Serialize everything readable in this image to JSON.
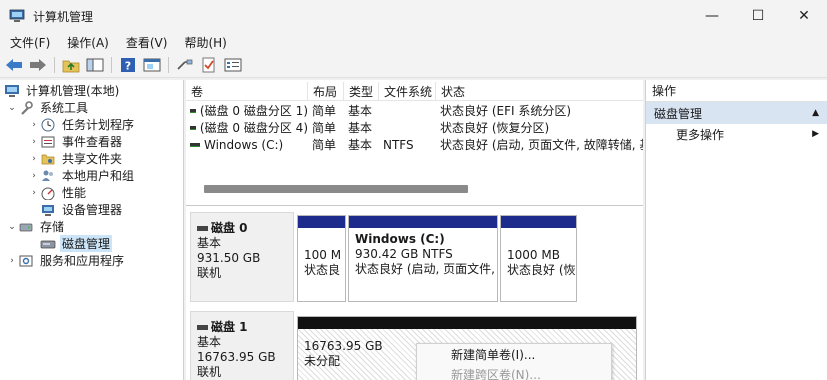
{
  "window": {
    "title": "计算机管理"
  },
  "window_controls": {
    "minimize": "—",
    "maximize": "☐",
    "close": "✕"
  },
  "menubar": {
    "items": [
      "文件(F)",
      "操作(A)",
      "查看(V)",
      "帮助(H)"
    ]
  },
  "tree": {
    "root": "计算机管理(本地)",
    "system_tools": "系统工具",
    "task_scheduler": "任务计划程序",
    "event_viewer": "事件查看器",
    "shared_folders": "共享文件夹",
    "local_users": "本地用户和组",
    "performance": "性能",
    "device_manager": "设备管理器",
    "storage": "存储",
    "disk_management": "磁盘管理",
    "services": "服务和应用程序"
  },
  "volume_list": {
    "columns": [
      "卷",
      "布局",
      "类型",
      "文件系统",
      "状态"
    ],
    "rows": [
      {
        "volume": "(磁盘 0 磁盘分区 1)",
        "layout": "简单",
        "type": "基本",
        "fs": "",
        "status": "状态良好 (EFI 系统分区)"
      },
      {
        "volume": "(磁盘 0 磁盘分区 4)",
        "layout": "简单",
        "type": "基本",
        "fs": "",
        "status": "状态良好 (恢复分区)"
      },
      {
        "volume": "Windows (C:)",
        "layout": "简单",
        "type": "基本",
        "fs": "NTFS",
        "status": "状态良好 (启动, 页面文件, 故障转储, 基"
      }
    ]
  },
  "disks": [
    {
      "name": "磁盘 0",
      "kind": "基本",
      "size": "931.50 GB",
      "state": "联机",
      "partitions": [
        {
          "title": "",
          "size": "100 M",
          "status": "状态良"
        },
        {
          "title": "Windows  (C:)",
          "size": "930.42 GB NTFS",
          "status": "状态良好 (启动, 页面文件, 故"
        },
        {
          "title": "",
          "size": "1000 MB",
          "status": "状态良好 (恢"
        }
      ]
    },
    {
      "name": "磁盘 1",
      "kind": "基本",
      "size": "16763.95 GB",
      "state": "联机",
      "unallocated": {
        "size": "16763.95 GB",
        "label": "未分配"
      }
    }
  ],
  "context_menu": {
    "items": [
      "新建简单卷(I)...",
      "新建跨区卷(N)..."
    ]
  },
  "actions": {
    "title": "操作",
    "section": "磁盘管理",
    "more": "更多操作"
  },
  "colors": {
    "partition_bar": "#1d2b8c",
    "unallocated_bar": "#111111",
    "selection": "#cce4f7"
  }
}
